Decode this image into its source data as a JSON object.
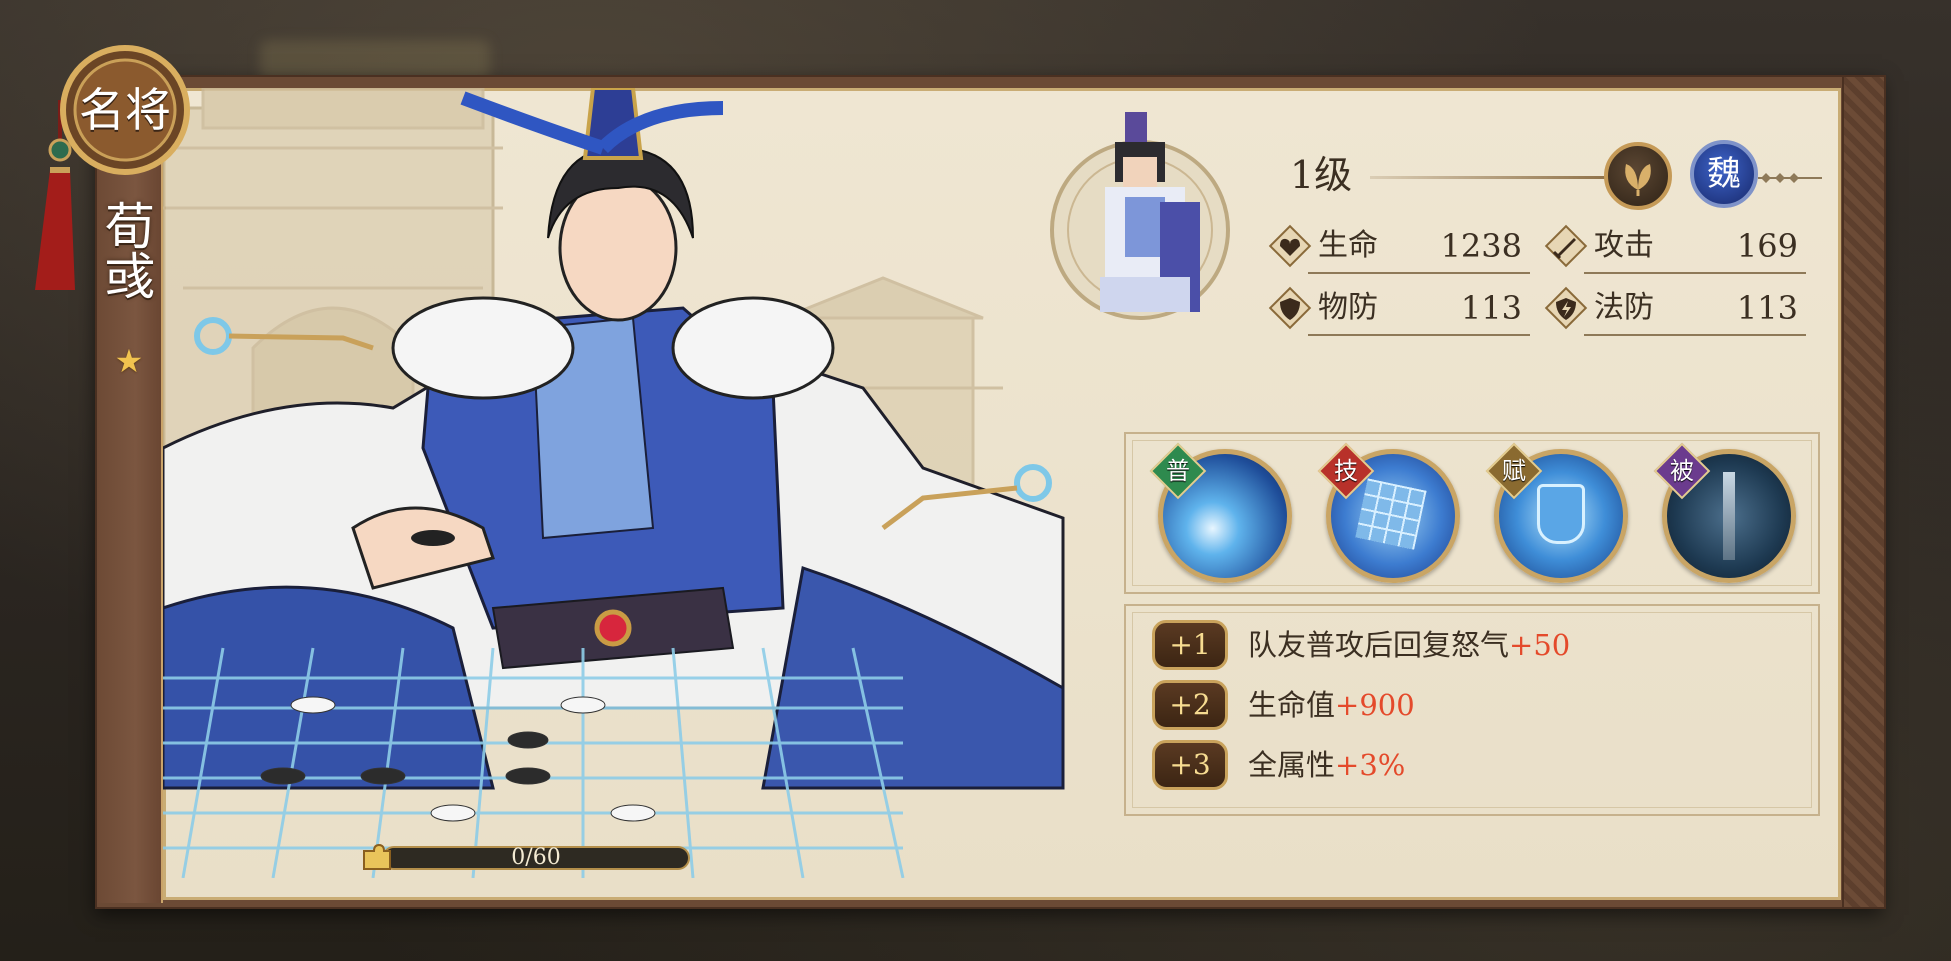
{
  "hero": {
    "rank_label": "名将",
    "name": "荀彧",
    "stars": "★",
    "level": "1级",
    "faction": "魏",
    "faction_color": "#2a3f9e",
    "name_color": "#ffffff"
  },
  "progress": {
    "text": "0/60",
    "value": 0,
    "max": 60
  },
  "stats": [
    {
      "label": "生命",
      "value": "1238",
      "icon": "heart-icon"
    },
    {
      "label": "攻击",
      "value": "169",
      "icon": "sword-icon"
    },
    {
      "label": "物防",
      "value": "113",
      "icon": "shield-icon"
    },
    {
      "label": "法防",
      "value": "113",
      "icon": "lightning-shield-icon"
    }
  ],
  "skills": [
    {
      "tag": "普",
      "tag_color": "#2e8a4e",
      "icon": "comet-skill-icon"
    },
    {
      "tag": "技",
      "tag_color": "#b8312a",
      "icon": "go-board-skill-icon"
    },
    {
      "tag": "赋",
      "tag_color": "#8a6a30",
      "icon": "shield-gate-skill-icon"
    },
    {
      "tag": "被",
      "tag_color": "#6b3b8e",
      "icon": "chained-sword-skill-icon"
    }
  ],
  "bonuses": [
    {
      "badge": "+1",
      "text": "队友普攻后回复怒气",
      "value": "+50"
    },
    {
      "badge": "+2",
      "text": "生命值",
      "value": "+900"
    },
    {
      "badge": "+3",
      "text": "全属性",
      "value": "+3%"
    }
  ],
  "colors": {
    "parchment": "#ece3cd",
    "frame_brown": "#6b4a35",
    "gold": "#c9a565",
    "bonus_value": "#e44a2b"
  }
}
